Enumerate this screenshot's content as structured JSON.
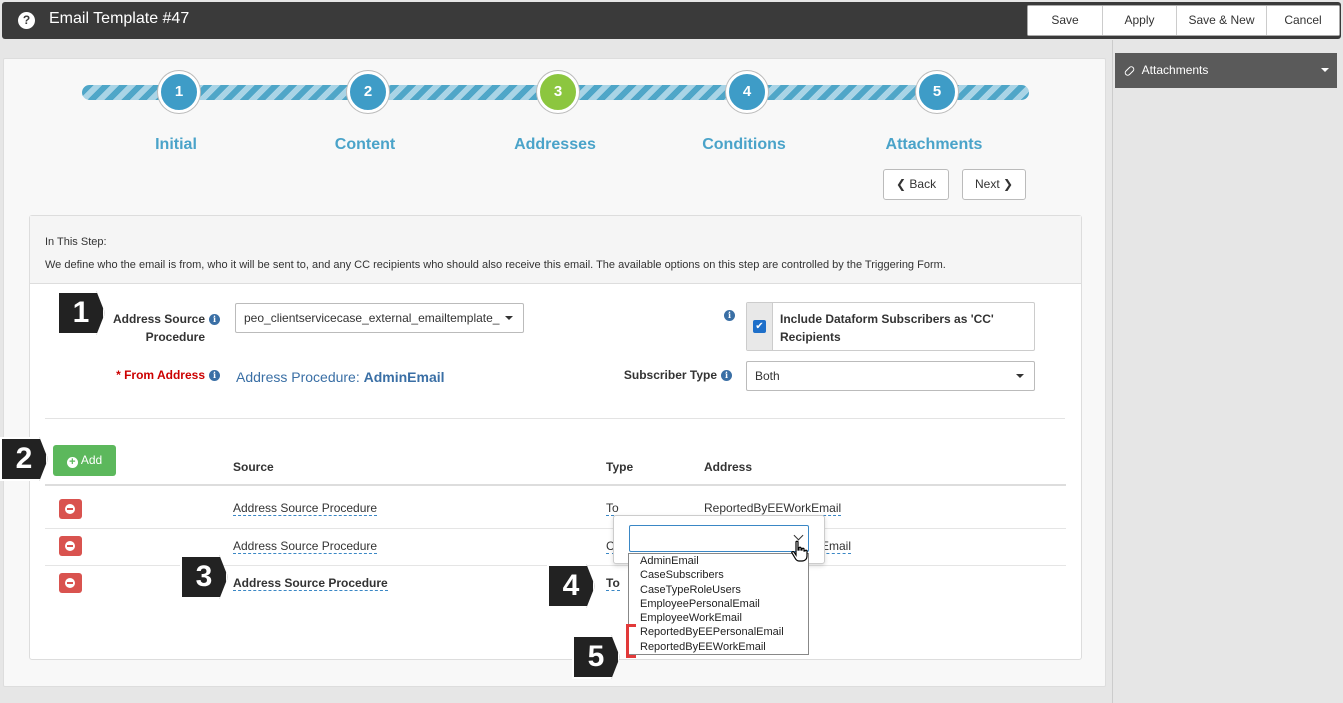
{
  "window": {
    "title": "Email Template #47",
    "help_icon": "?"
  },
  "toolbar": {
    "save": "Save",
    "apply": "Apply",
    "save_new": "Save & New",
    "cancel": "Cancel"
  },
  "right_panel": {
    "attachments_label": "Attachments"
  },
  "wizard": {
    "steps": [
      {
        "number": "1",
        "label": "Initial"
      },
      {
        "number": "2",
        "label": "Content"
      },
      {
        "number": "3",
        "label": "Addresses"
      },
      {
        "number": "4",
        "label": "Conditions"
      },
      {
        "number": "5",
        "label": "Attachments"
      }
    ],
    "active_step": 3,
    "back_label": "Back",
    "next_label": "Next"
  },
  "step_info": {
    "title": "In This Step:",
    "description": "We define who the email is from, who it will be sent to, and any CC recipients who should also receive this email. The available options on this step are controlled by the Triggering Form."
  },
  "form": {
    "address_source_label_1": "Address Source",
    "address_source_label_2": "Procedure",
    "address_source_value": "peo_clientservicecase_external_emailtemplate_",
    "from_label": "* From Address",
    "from_prefix": "Address Procedure:",
    "from_value": "AdminEmail",
    "cc_label": "Include Dataform Subscribers as 'CC' Recipients",
    "cc_checked": true,
    "subscriber_type_label": "Subscriber Type",
    "subscriber_type_value": "Both"
  },
  "table": {
    "add_label": "Add",
    "headers": {
      "source": "Source",
      "type": "Type",
      "address": "Address"
    },
    "rows": [
      {
        "source": "Address Source Procedure",
        "type": "To",
        "address": "ReportedByEEWorkEmail"
      },
      {
        "source": "Address Source Procedure",
        "type": "C",
        "address": "Email"
      },
      {
        "source": "Address Source Procedure",
        "type": "To",
        "address": ""
      }
    ]
  },
  "dropdown": {
    "options": [
      "AdminEmail",
      "CaseSubscribers",
      "CaseTypeRoleUsers",
      "EmployeePersonalEmail",
      "EmployeeWorkEmail",
      "ReportedByEEPersonalEmail",
      "ReportedByEEWorkEmail"
    ]
  },
  "callouts": [
    "1",
    "2",
    "3",
    "4",
    "5"
  ],
  "colors": {
    "titlebar": "#3a3a3a",
    "step": "#3e9cc7",
    "step_active": "#8cc63f",
    "add": "#5cb85c",
    "remove": "#d9534f",
    "required": "#cc0000",
    "link": "#3a6fa5"
  }
}
